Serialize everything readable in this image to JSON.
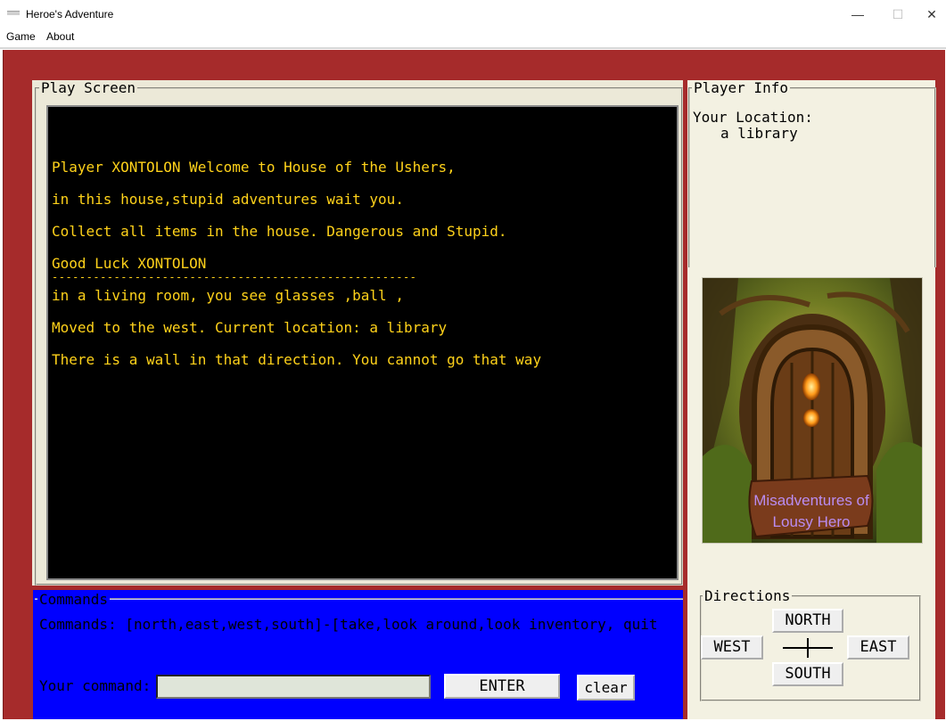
{
  "window": {
    "title": "Heroe's Adventure",
    "minimize": "—",
    "maximize": "☐",
    "close": "✕"
  },
  "menu": {
    "items": [
      "Game",
      "About"
    ]
  },
  "play": {
    "title": "Play Screen",
    "lines": [
      "Player XONTOLON Welcome to House of the Ushers,",
      "in this house,stupid adventures wait you.",
      "Collect all items in the house. Dangerous and Stupid.",
      "Good Luck XONTOLON",
      "-----------------------------------------------------",
      "in a living room, you see glasses ,ball ,",
      "Moved to the west. Current location: a library",
      "There is a wall in that direction. You cannot go that way"
    ]
  },
  "info": {
    "title": "Player Info",
    "location_label": "Your Location:",
    "location_value": "a library",
    "poster_line1": "Misadventures of",
    "poster_line2": "Lousy Hero"
  },
  "directions": {
    "title": "Directions",
    "north": "NORTH",
    "south": "SOUTH",
    "west": "WEST",
    "east": "EAST"
  },
  "commands": {
    "title": "Commands",
    "help": "Commands: [north,east,west,south]-[take,look around,look inventory, quit",
    "prompt": "Your command:",
    "input_value": "",
    "enter": "ENTER",
    "clear": "clear"
  },
  "colors": {
    "frame": "#a62b2b",
    "screen_bg": "#000000",
    "screen_text": "#ffd21a",
    "command_bg": "#0000ff",
    "panel_bg": "#f3f1e2"
  }
}
